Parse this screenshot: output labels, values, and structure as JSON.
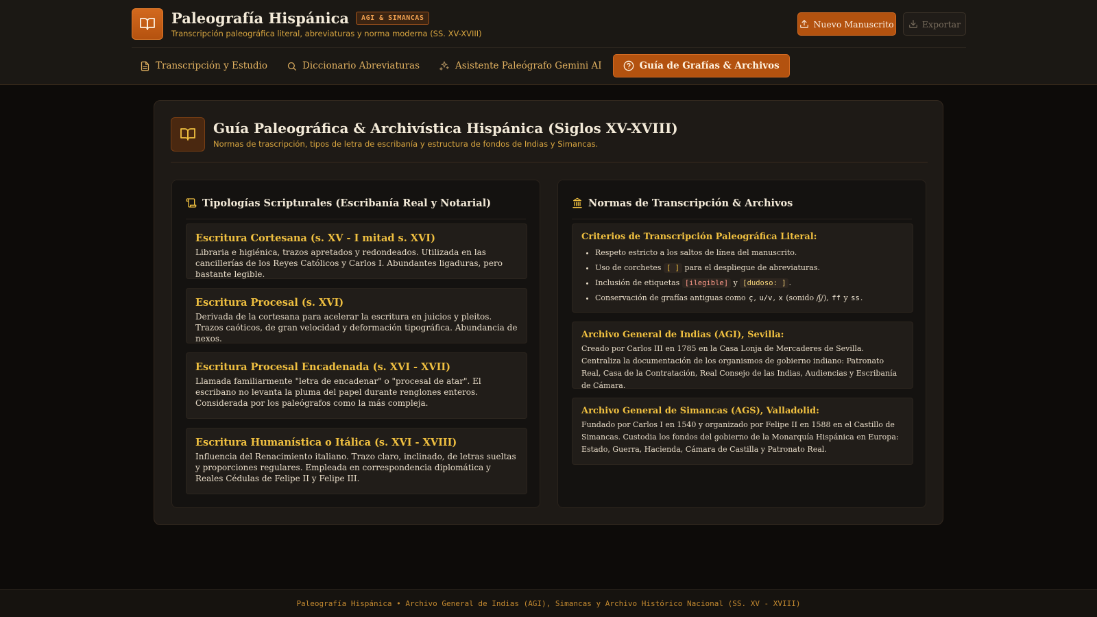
{
  "app": {
    "title": "Paleografía Hispánica",
    "badge": "AGI & SIMANCAS",
    "subtitle": "Transcripción paleográfica literal, abreviaturas y norma moderna (SS. XV-XVIII)"
  },
  "actions": {
    "new_label": "Nuevo Manuscrito",
    "export_label": "Exportar"
  },
  "tabs": [
    {
      "label": "Transcripción y Estudio",
      "icon": "document-icon",
      "active": false
    },
    {
      "label": "Diccionario Abreviaturas",
      "icon": "search-icon",
      "active": false
    },
    {
      "label": "Asistente Paleógrafo Gemini AI",
      "icon": "sparkles-icon",
      "active": false
    },
    {
      "label": "Guía de Grafías & Archivos",
      "icon": "help-circle-icon",
      "active": true
    }
  ],
  "guide": {
    "title": "Guía Paleográfica & Archivística Hispánica (Siglos XV-XVIII)",
    "subtitle": "Normas de trascripción, tipos de letra de escribanía y estructura de fondos de Indias y Simancas."
  },
  "left_panel": {
    "title": "Tipologías Scripturales (Escribanía Real y Notarial)",
    "items": [
      {
        "title": "Escritura Cortesana (s. XV - I mitad s. XVI)",
        "desc": "Libraria e higiénica, trazos apretados y redondeados. Utilizada en las cancillerías de los Reyes Católicos y Carlos I. Abundantes ligaduras, pero bastante legible."
      },
      {
        "title": "Escritura Procesal (s. XVI)",
        "desc": "Derivada de la cortesana para acelerar la escritura en juicios y pleitos. Trazos caóticos, de gran velocidad y deformación tipográfica. Abundancia de nexos."
      },
      {
        "title": "Escritura Procesal Encadenada (s. XVI - XVII)",
        "desc": "Llamada familiarmente \"letra de encadenar\" o \"procesal de atar\". El escribano no levanta la pluma del papel durante renglones enteros. Considerada por los paleógrafos como la más compleja."
      },
      {
        "title": "Escritura Humanística o Itálica (s. XVI - XVIII)",
        "desc": "Influencia del Renacimiento italiano. Trazo claro, inclinado, de letras sueltas y proporciones regulares. Empleada en correspondencia diplomática y Reales Cédulas de Felipe II y Felipe III."
      }
    ]
  },
  "right_panel": {
    "title": "Normas de Transcripción & Archivos",
    "criteria": {
      "title": "Criterios de Transcripción Paleográfica Literal:",
      "li1": "Respeto estricto a los saltos de línea del manuscrito.",
      "li2_pre": "Uso de corchetes",
      "li2_code": "[ ]",
      "li2_post": "para el despliegue de abreviaturas.",
      "li3_pre": "Inclusión de etiquetas",
      "li3_code1": "[ilegible]",
      "li3_mid": "y",
      "li3_code2": "[dudoso: ]",
      "li3_post": ".",
      "li4_pre": "Conservación de grafías antiguas como",
      "li4_c1": "ç",
      "li4_c2": "u/v",
      "li4_c3": "x",
      "li4_mid": "(sonido /ʃ/),",
      "li4_c4": "ff",
      "li4_y": "y",
      "li4_c5": "ss",
      "li4_end": "."
    },
    "archives": [
      {
        "title": "Archivo General de Indias (AGI), Sevilla:",
        "desc": "Creado por Carlos III en 1785 en la Casa Lonja de Mercaderes de Sevilla. Centraliza la documentación de los organismos de gobierno indiano: Patronato Real, Casa de la Contratación, Real Consejo de las Indias, Audiencias y Escribanía de Cámara."
      },
      {
        "title": "Archivo General de Simancas (AGS), Valladolid:",
        "desc": "Fundado por Carlos I en 1540 y organizado por Felipe II en 1588 en el Castillo de Simancas. Custodia los fondos del gobierno de la Monarquía Hispánica en Europa: Estado, Guerra, Hacienda, Cámara de Castilla y Patronato Real."
      }
    ]
  },
  "footer": {
    "text": "Paleografía Hispánica • Archivo General de Indias (AGI), Simancas y Archivo Histórico Nacional (SS. XV - XVIII)"
  },
  "colors": {
    "accent": "#b3520f",
    "gold": "#f0c040",
    "background": "#0d0b09"
  }
}
